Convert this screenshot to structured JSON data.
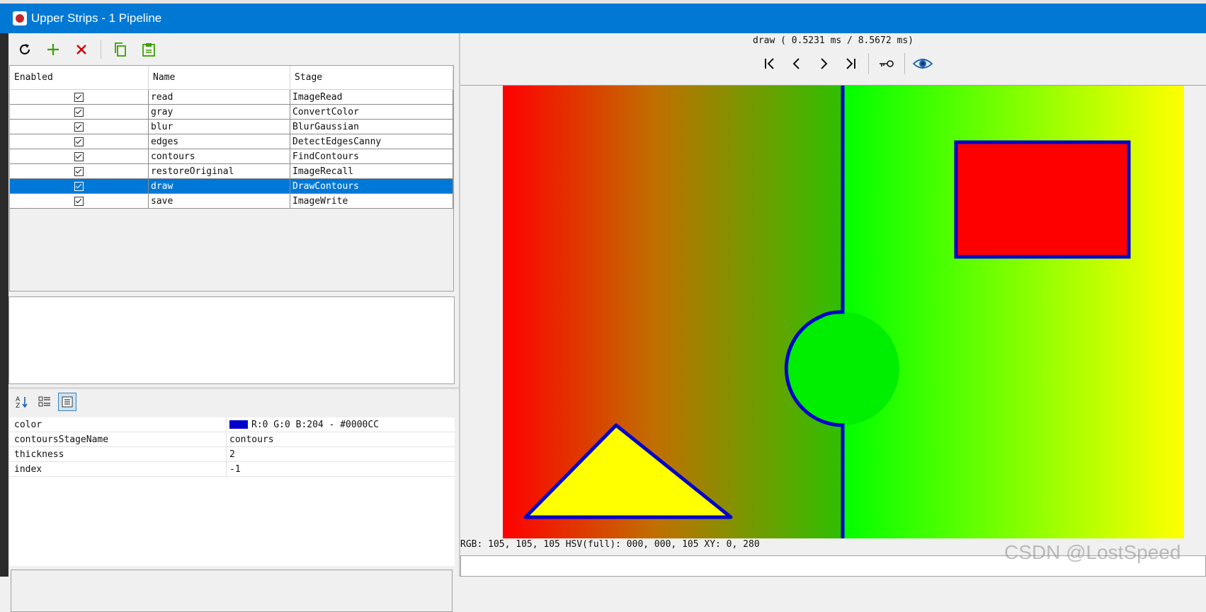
{
  "window": {
    "title": "Upper Strips - 1 Pipeline"
  },
  "toolbar": {
    "icons": [
      "refresh-icon",
      "add-icon",
      "delete-icon",
      "copy-icon",
      "paste-icon"
    ],
    "colors": {
      "refresh": "#111111",
      "add": "#3aa000",
      "delete": "#d00000",
      "copy": "#3aa000",
      "paste": "#3aa000"
    }
  },
  "table": {
    "headers": [
      "Enabled",
      "Name",
      "Stage"
    ],
    "rows": [
      {
        "enabled": true,
        "name": "read",
        "stage": "ImageRead"
      },
      {
        "enabled": true,
        "name": "gray",
        "stage": "ConvertColor"
      },
      {
        "enabled": true,
        "name": "blur",
        "stage": "BlurGaussian"
      },
      {
        "enabled": true,
        "name": "edges",
        "stage": "DetectEdgesCanny"
      },
      {
        "enabled": true,
        "name": "contours",
        "stage": "FindContours"
      },
      {
        "enabled": true,
        "name": "restoreOriginal",
        "stage": "ImageRecall"
      },
      {
        "enabled": true,
        "name": "draw",
        "stage": "DrawContours",
        "selected": true
      },
      {
        "enabled": true,
        "name": "save",
        "stage": "ImageWrite"
      }
    ]
  },
  "properties": {
    "toolbar_icons": [
      "sort-alphabetical-icon",
      "categorized-icon",
      "property-pages-icon"
    ],
    "rows": [
      {
        "name": "color",
        "value": "R:0 G:0 B:204 - #0000CC",
        "swatch": "#0000CC"
      },
      {
        "name": "contoursStageName",
        "value": "contours"
      },
      {
        "name": "thickness",
        "value": "2"
      },
      {
        "name": "index",
        "value": "-1"
      }
    ]
  },
  "viewer": {
    "timing": "draw ( 0.5231 ms / 8.5672 ms)",
    "nav_icons": [
      "first-icon",
      "prev-icon",
      "next-icon",
      "last-icon",
      "key-icon",
      "eye-icon"
    ],
    "status": "RGB: 105, 105, 105 HSV(full): 000, 000, 105 XY: 0, 280",
    "image_colors": {
      "gradient_left_start": "#ff0000",
      "gradient_left_mid": "#c07000",
      "gradient_left_end": "#00ff00",
      "gradient_right_end": "#ffff00",
      "contour": "#0000cc",
      "rect_fill": "#ff0000",
      "circle_fill": "#00ee00",
      "triangle_fill": "#ffff00"
    }
  },
  "watermark": "CSDN @LostSpeed"
}
